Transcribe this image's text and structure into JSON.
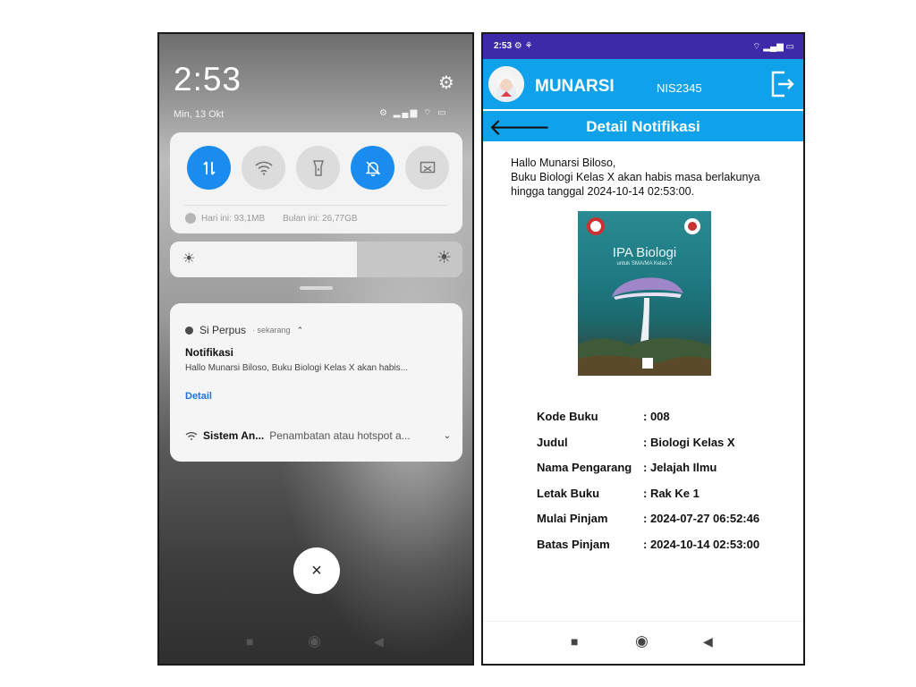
{
  "left": {
    "clock": "2:53",
    "date": "Min, 13 Okt",
    "status_icons": "⚙ ▂▄▆ ⌔ ▭",
    "quick_settings": {
      "toggles": [
        {
          "icon": "data-transfer-icon",
          "on": true
        },
        {
          "icon": "wifi-icon",
          "on": false
        },
        {
          "icon": "flashlight-icon",
          "on": false
        },
        {
          "icon": "mute-bell-icon",
          "on": true
        },
        {
          "icon": "screenshot-icon",
          "on": false
        }
      ],
      "usage_today": "Hari ini: 93,1MB",
      "usage_month": "Bulan ini: 26,77GB"
    },
    "brightness_level": 0.64,
    "notification": {
      "app": "Si Perpus",
      "time": "· sekarang",
      "title": "Notifikasi",
      "body": "Hallo Munarsi Biloso, Buku Biologi Kelas X akan habis...",
      "action": "Detail",
      "secondary_title": "Sistem An...",
      "secondary_text": "Penambatan atau hotspot a..."
    },
    "close_label": "×"
  },
  "right": {
    "status_time": "2:53",
    "user_name": "MUNARSI",
    "nis": "NIS2345",
    "page_title": "Detail Notifikasi",
    "message": {
      "line1": "Hallo Munarsi Biloso,",
      "line2": "Buku Biologi Kelas X akan habis masa berlakunya",
      "line3": "hingga tanggal 2024-10-14 02:53:00."
    },
    "book_cover_title": "IPA Biologi",
    "book_cover_subtitle": "untuk SMA/MA Kelas X",
    "details": [
      {
        "label": "Kode Buku",
        "value": ": 008"
      },
      {
        "label": "Judul",
        "value": ": Biologi Kelas X"
      },
      {
        "label": "Nama Pengarang",
        "value": ": Jelajah Ilmu"
      },
      {
        "label": "Letak Buku",
        "value": ": Rak Ke 1"
      },
      {
        "label": "Mulai Pinjam",
        "value": ": 2024-07-27 06:52:46"
      },
      {
        "label": "Batas Pinjam",
        "value": ": 2024-10-14 02:53:00"
      }
    ]
  },
  "colors": {
    "accent": "#1a8cf0",
    "header": "#0fa2ea",
    "status_bar": "#3c2aa8"
  }
}
